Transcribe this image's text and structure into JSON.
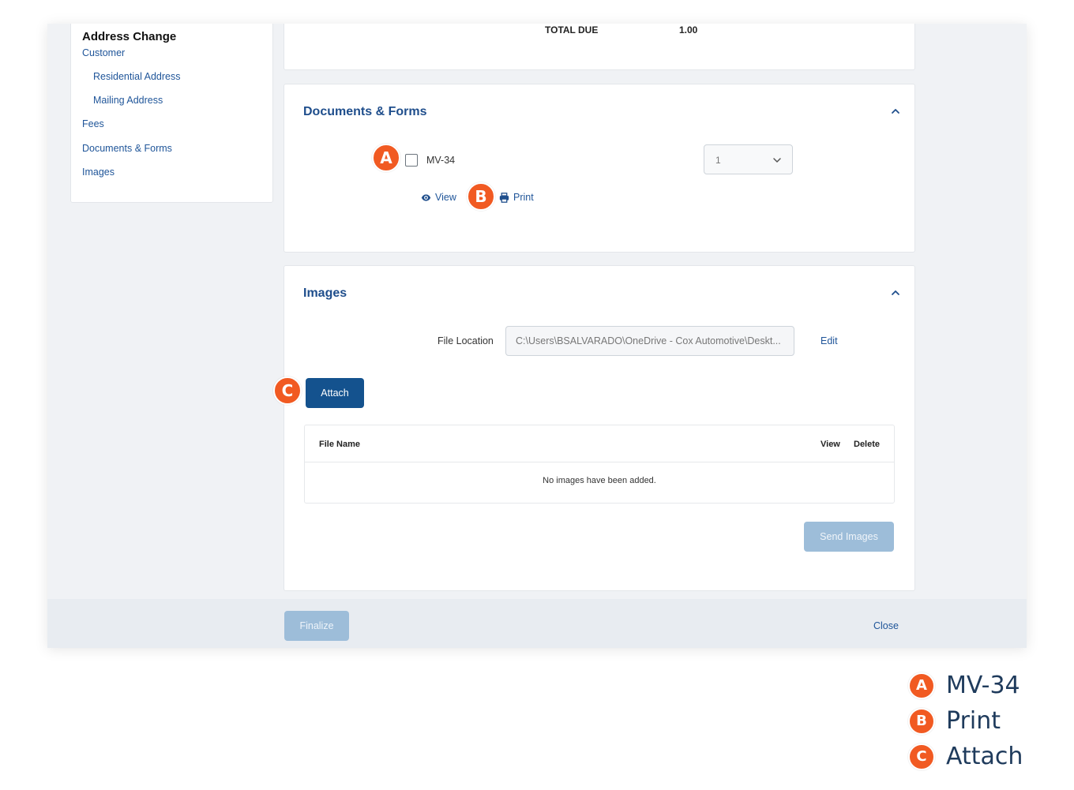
{
  "sidebar": {
    "title": "Address Change",
    "items": [
      {
        "label": "Customer"
      },
      {
        "label": "Residential Address"
      },
      {
        "label": "Mailing Address"
      },
      {
        "label": "Fees"
      },
      {
        "label": "Documents & Forms"
      },
      {
        "label": "Images"
      }
    ]
  },
  "summary": {
    "total_label": "TOTAL DUE",
    "total_value": "1.00"
  },
  "documents": {
    "title": "Documents & Forms",
    "form_label": "MV-34",
    "checked": false,
    "copies_value": "1",
    "view_label": "View",
    "print_label": "Print"
  },
  "images": {
    "title": "Images",
    "file_location_label": "File Location",
    "file_location_value": "C:\\Users\\BSALVARADO\\OneDrive - Cox Automotive\\Deskt...",
    "edit_label": "Edit",
    "attach_label": "Attach",
    "table": {
      "columns": [
        "File Name",
        "View",
        "Delete"
      ],
      "empty_message": "No images have been added."
    },
    "send_label": "Send Images"
  },
  "footer": {
    "finalize_label": "Finalize",
    "close_label": "Close"
  },
  "callouts": {
    "a": "A",
    "b": "B",
    "c": "C"
  },
  "legend": [
    {
      "letter": "A",
      "label": "MV-34"
    },
    {
      "letter": "B",
      "label": "Print"
    },
    {
      "letter": "C",
      "label": "Attach"
    }
  ],
  "colors": {
    "primary": "#14528e",
    "link": "#1f5599",
    "heading": "#1f4e8c",
    "disabled_button": "#9dbdd9",
    "callout": "#f15a22",
    "legend_text": "#1f3b5c"
  },
  "icons": {
    "view": "eye-icon",
    "print": "printer-icon",
    "collapse": "chevron-up-icon",
    "select": "chevron-down-icon"
  }
}
